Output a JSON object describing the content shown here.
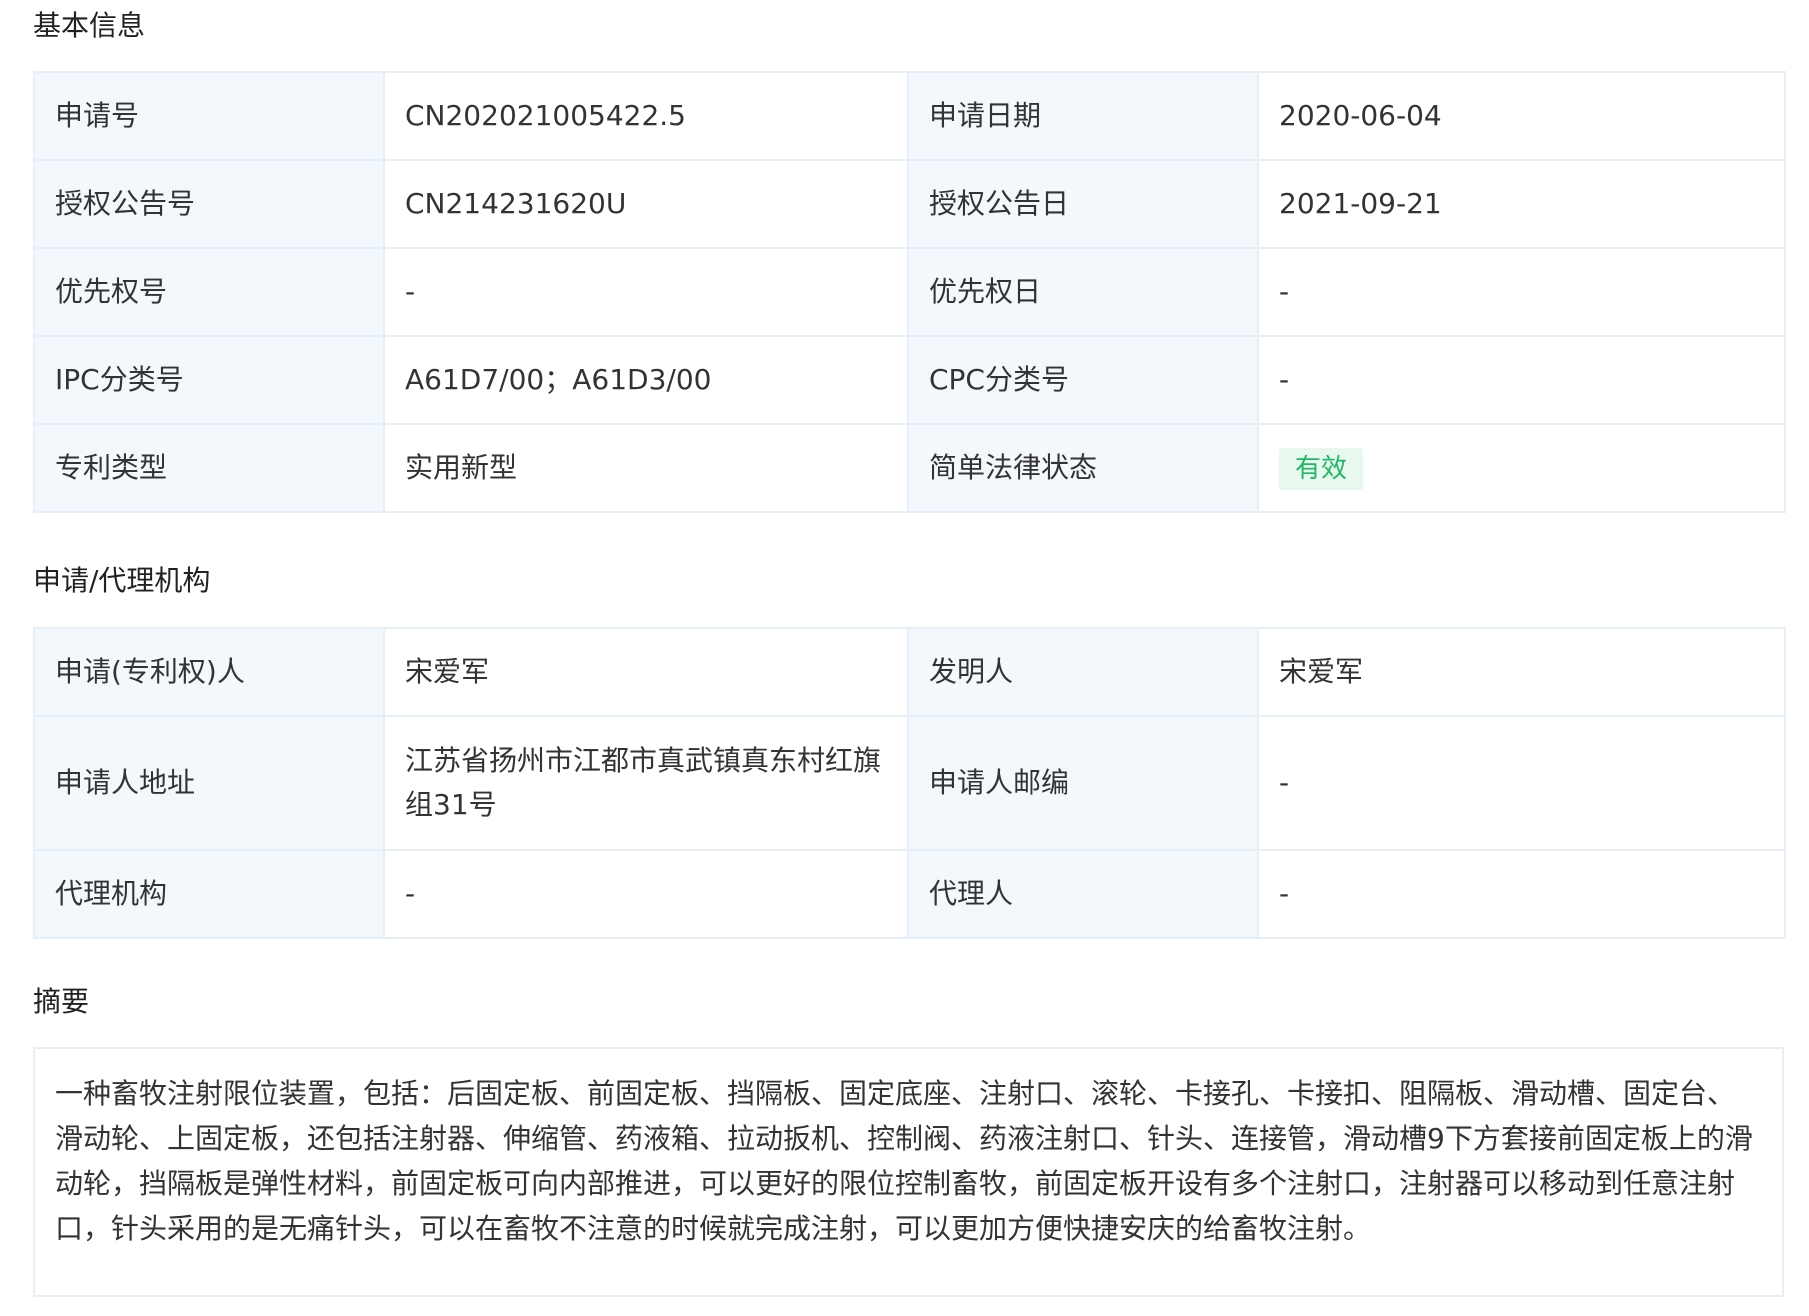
{
  "basic": {
    "title": "基本信息",
    "rows": [
      {
        "l1": "申请号",
        "v1": "CN202021005422.5",
        "l2": "申请日期",
        "v2": "2020-06-04"
      },
      {
        "l1": "授权公告号",
        "v1": "CN214231620U",
        "l2": "授权公告日",
        "v2": "2021-09-21"
      },
      {
        "l1": "优先权号",
        "v1": "-",
        "l2": "优先权日",
        "v2": "-"
      },
      {
        "l1": "IPC分类号",
        "v1": "A61D7/00；A61D3/00",
        "l2": "CPC分类号",
        "v2": "-"
      },
      {
        "l1": "专利类型",
        "v1": "实用新型",
        "l2": "简单法律状态",
        "v2": "有效"
      }
    ],
    "status_color": "#1fb964",
    "status_bg": "#e8f8ef"
  },
  "agency": {
    "title": "申请/代理机构",
    "rows": [
      {
        "l1": "申请(专利权)人",
        "v1": "宋爱军",
        "l2": "发明人",
        "v2": "宋爱军"
      },
      {
        "l1": "申请人地址",
        "v1": "江苏省扬州市江都市真武镇真东村红旗组31号",
        "l2": "申请人邮编",
        "v2": "-"
      },
      {
        "l1": "代理机构",
        "v1": "-",
        "l2": "代理人",
        "v2": "-"
      }
    ]
  },
  "abstract": {
    "title": "摘要",
    "text": "一种畜牧注射限位装置，包括：后固定板、前固定板、挡隔板、固定底座、注射口、滚轮、卡接孔、卡接扣、阻隔板、滑动槽、固定台、滑动轮、上固定板，还包括注射器、伸缩管、药液箱、拉动扳机、控制阀、药液注射口、针头、连接管，滑动槽9下方套接前固定板上的滑动轮，挡隔板是弹性材料，前固定板可向内部推进，可以更好的限位控制畜牧，前固定板开设有多个注射口，注射器可以移动到任意注射口，针头采用的是无痛针头，可以在畜牧不注意的时候就完成注射，可以更加方便快捷安庆的给畜牧注射。"
  },
  "colors": {
    "label_bg": "#f3f8fc",
    "border": "#e6eef8",
    "text": "#333333"
  }
}
